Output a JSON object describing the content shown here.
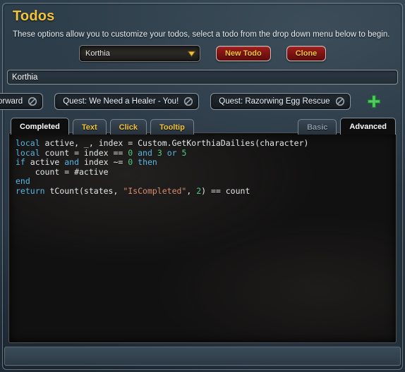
{
  "window": {
    "title": "Todos",
    "subtitle": "These options allow you to customize your todos, select a todo from the drop down menu below to begin."
  },
  "controls": {
    "dropdown": {
      "name": "todo-dropdown",
      "selected": "Korthia",
      "arrow_icon": "chevron-down-icon"
    },
    "new_todo_label": "New Todo",
    "clone_label": "Clone"
  },
  "name_field": {
    "value": "Korthia",
    "placeholder": "Korthia"
  },
  "tags": {
    "items": [
      {
        "label": "Forward",
        "remove_icon": "ban-circle-icon"
      },
      {
        "label": "Quest: We Need a Healer - You!",
        "remove_icon": "ban-circle-icon"
      },
      {
        "label": "Quest: Razorwing Egg Rescue",
        "remove_icon": "ban-circle-icon"
      }
    ],
    "add_icon": "plus-icon"
  },
  "tabs": {
    "left": [
      {
        "label": "Completed",
        "active": true
      },
      {
        "label": "Text",
        "active": false
      },
      {
        "label": "Click",
        "active": false
      },
      {
        "label": "Tooltip",
        "active": false
      }
    ],
    "right": [
      {
        "label": "Basic",
        "active": false
      },
      {
        "label": "Advanced",
        "active": true
      }
    ]
  },
  "editor": {
    "language": "lua",
    "lines": [
      [
        {
          "t": "local",
          "c": "kw"
        },
        {
          "t": " active, _, index = Custom.GetKorthiaDailies(character)",
          "c": "id"
        }
      ],
      [
        {
          "t": "local",
          "c": "kw"
        },
        {
          "t": " count = index == ",
          "c": "id"
        },
        {
          "t": "0",
          "c": "num"
        },
        {
          "t": " ",
          "c": "id"
        },
        {
          "t": "and",
          "c": "kw"
        },
        {
          "t": " ",
          "c": "id"
        },
        {
          "t": "3",
          "c": "num"
        },
        {
          "t": " ",
          "c": "id"
        },
        {
          "t": "or",
          "c": "kw"
        },
        {
          "t": " ",
          "c": "id"
        },
        {
          "t": "5",
          "c": "num"
        }
      ],
      [
        {
          "t": "if",
          "c": "kw"
        },
        {
          "t": " active ",
          "c": "id"
        },
        {
          "t": "and",
          "c": "kw"
        },
        {
          "t": " index ~= ",
          "c": "id"
        },
        {
          "t": "0",
          "c": "num"
        },
        {
          "t": " ",
          "c": "id"
        },
        {
          "t": "then",
          "c": "kw"
        }
      ],
      [
        {
          "t": "    count = #active",
          "c": "id"
        }
      ],
      [
        {
          "t": "end",
          "c": "kw"
        }
      ],
      [
        {
          "t": "return",
          "c": "kw"
        },
        {
          "t": " tCount(states, ",
          "c": "id"
        },
        {
          "t": "\"IsCompleted\"",
          "c": "str"
        },
        {
          "t": ", ",
          "c": "id"
        },
        {
          "t": "2",
          "c": "num"
        },
        {
          "t": ") == count",
          "c": "id"
        }
      ]
    ]
  },
  "colors": {
    "title_gold": "#f2c43a",
    "button_red": "#7d1313",
    "accent_green": "#3fbf4f",
    "keyword_blue": "#56b6e0",
    "number_green": "#4ec982",
    "string_orange": "#d98b6a",
    "panel_blue": "#2b3a46"
  }
}
